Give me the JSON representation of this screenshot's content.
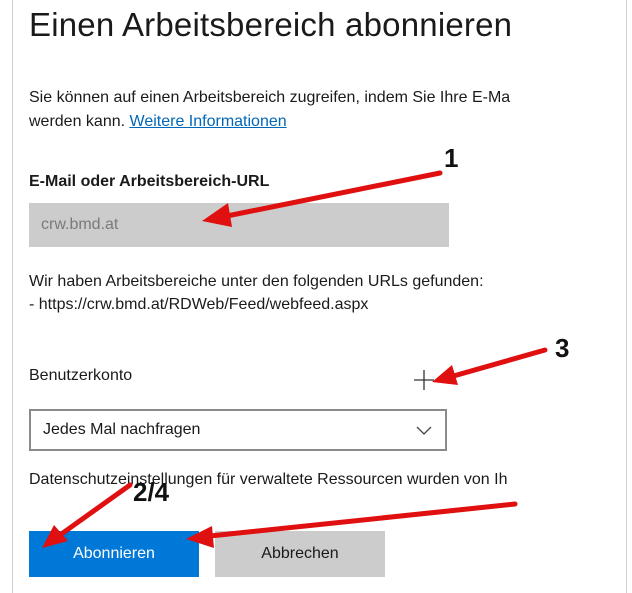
{
  "dialog": {
    "title": "Einen Arbeitsbereich abonnieren",
    "description_line1": "Sie können auf einen Arbeitsbereich zugreifen, indem Sie Ihre E-Ma",
    "description_line2": "werden kann.",
    "more_info_link": "Weitere Informationen",
    "email_label": "E-Mail oder Arbeitsbereich-URL",
    "email_value": "crw.bmd.at",
    "found_line1": "Wir haben Arbeitsbereiche unter den folgenden URLs gefunden:",
    "found_line2": "- https://crw.bmd.at/RDWeb/Feed/webfeed.aspx",
    "account_label": "Benutzerkonto",
    "account_selected": "Jedes Mal nachfragen",
    "privacy_text": "Datenschutzeinstellungen für verwaltete Ressourcen wurden von Ih",
    "subscribe_button": "Abonnieren",
    "cancel_button": "Abbrechen"
  },
  "annotations": {
    "label_1": "1",
    "label_3": "3",
    "label_2_4": "2/4",
    "arrow_color": "#e01010"
  },
  "icons": {
    "add": "plus-icon",
    "dropdown": "chevron-down-icon"
  },
  "colors": {
    "accent": "#0078d7",
    "link": "#0067b8",
    "input_bg": "#cccccc"
  }
}
